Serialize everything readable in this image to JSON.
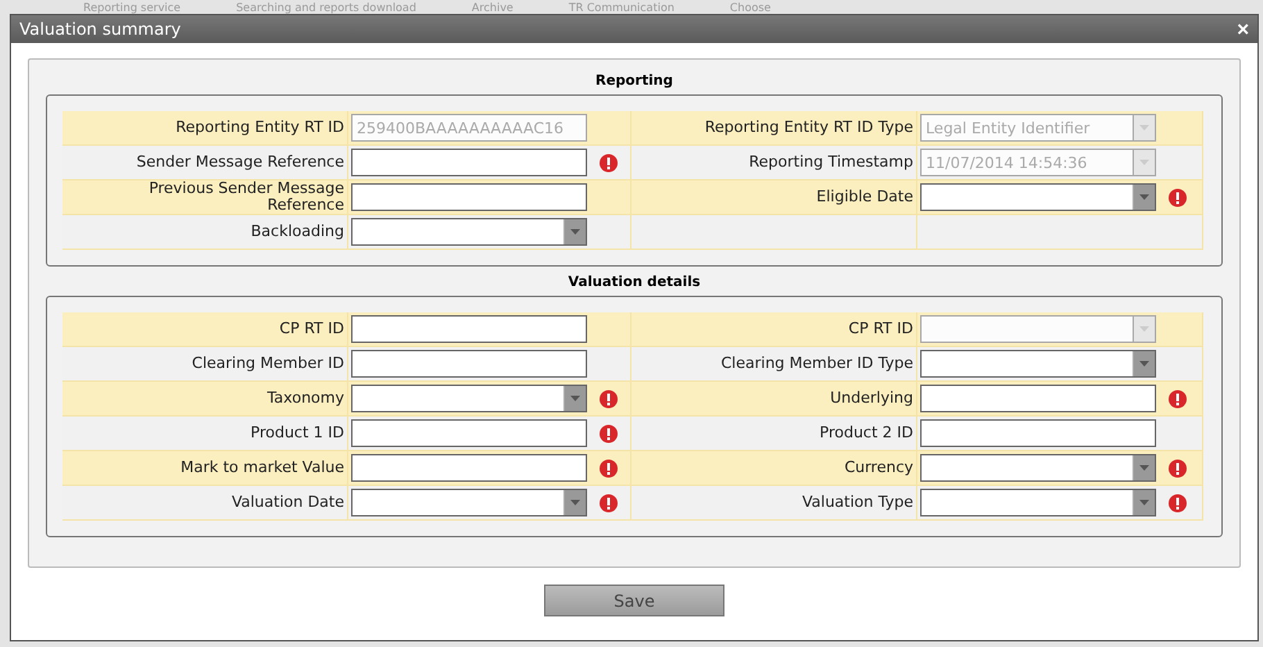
{
  "background_tabs": [
    {
      "label": "Reporting service"
    },
    {
      "label": "Searching and reports download"
    },
    {
      "label": "Archive"
    },
    {
      "label": "TR Communication"
    },
    {
      "label": "Choose"
    }
  ],
  "dialog": {
    "title": "Valuation summary",
    "close": "×",
    "sections": [
      {
        "title": "Reporting",
        "rows": [
          {
            "left": {
              "label": "Reporting Entity RT ID",
              "kind": "text",
              "value": "259400BAAAAAAAAAAC16",
              "disabled": true,
              "error": false
            },
            "right": {
              "label": "Reporting Entity RT ID Type",
              "kind": "select",
              "value": "Legal Entity Identifier",
              "disabled": true,
              "error": false
            }
          },
          {
            "left": {
              "label": "Sender Message Reference",
              "kind": "text",
              "disabled": false,
              "error": true
            },
            "right": {
              "label": "Reporting Timestamp",
              "kind": "select",
              "value": "11/07/2014 14:54:36",
              "disabled": true,
              "error": false
            }
          },
          {
            "left": {
              "label": "Previous Sender Message Reference",
              "kind": "text",
              "disabled": false,
              "error": false
            },
            "right": {
              "label": "Eligible Date",
              "kind": "select",
              "disabled": false,
              "error": true
            }
          },
          {
            "left": {
              "label": "Backloading",
              "kind": "select",
              "disabled": false,
              "error": false
            }
          }
        ]
      },
      {
        "title": "Valuation details",
        "rows": [
          {
            "left": {
              "label": "CP RT ID",
              "kind": "text",
              "disabled": false,
              "error": false
            },
            "right": {
              "label": "CP RT ID",
              "kind": "select",
              "disabled": true,
              "error": false
            }
          },
          {
            "left": {
              "label": "Clearing Member ID",
              "kind": "text",
              "disabled": false,
              "error": false
            },
            "right": {
              "label": "Clearing Member ID Type",
              "kind": "select",
              "disabled": false,
              "error": false
            }
          },
          {
            "left": {
              "label": "Taxonomy",
              "kind": "select",
              "disabled": false,
              "error": true
            },
            "right": {
              "label": "Underlying",
              "kind": "text",
              "disabled": false,
              "error": true
            }
          },
          {
            "left": {
              "label": "Product 1 ID",
              "kind": "text",
              "disabled": false,
              "error": true
            },
            "right": {
              "label": "Product 2 ID",
              "kind": "text",
              "disabled": false,
              "error": false
            }
          },
          {
            "left": {
              "label": "Mark to market Value",
              "kind": "text",
              "disabled": false,
              "error": true
            },
            "right": {
              "label": "Currency",
              "kind": "select",
              "disabled": false,
              "error": true
            }
          },
          {
            "left": {
              "label": "Valuation Date",
              "kind": "select",
              "disabled": false,
              "error": true
            },
            "right": {
              "label": "Valuation Type",
              "kind": "select",
              "disabled": false,
              "error": true
            }
          }
        ]
      }
    ],
    "save_button": "Save"
  }
}
